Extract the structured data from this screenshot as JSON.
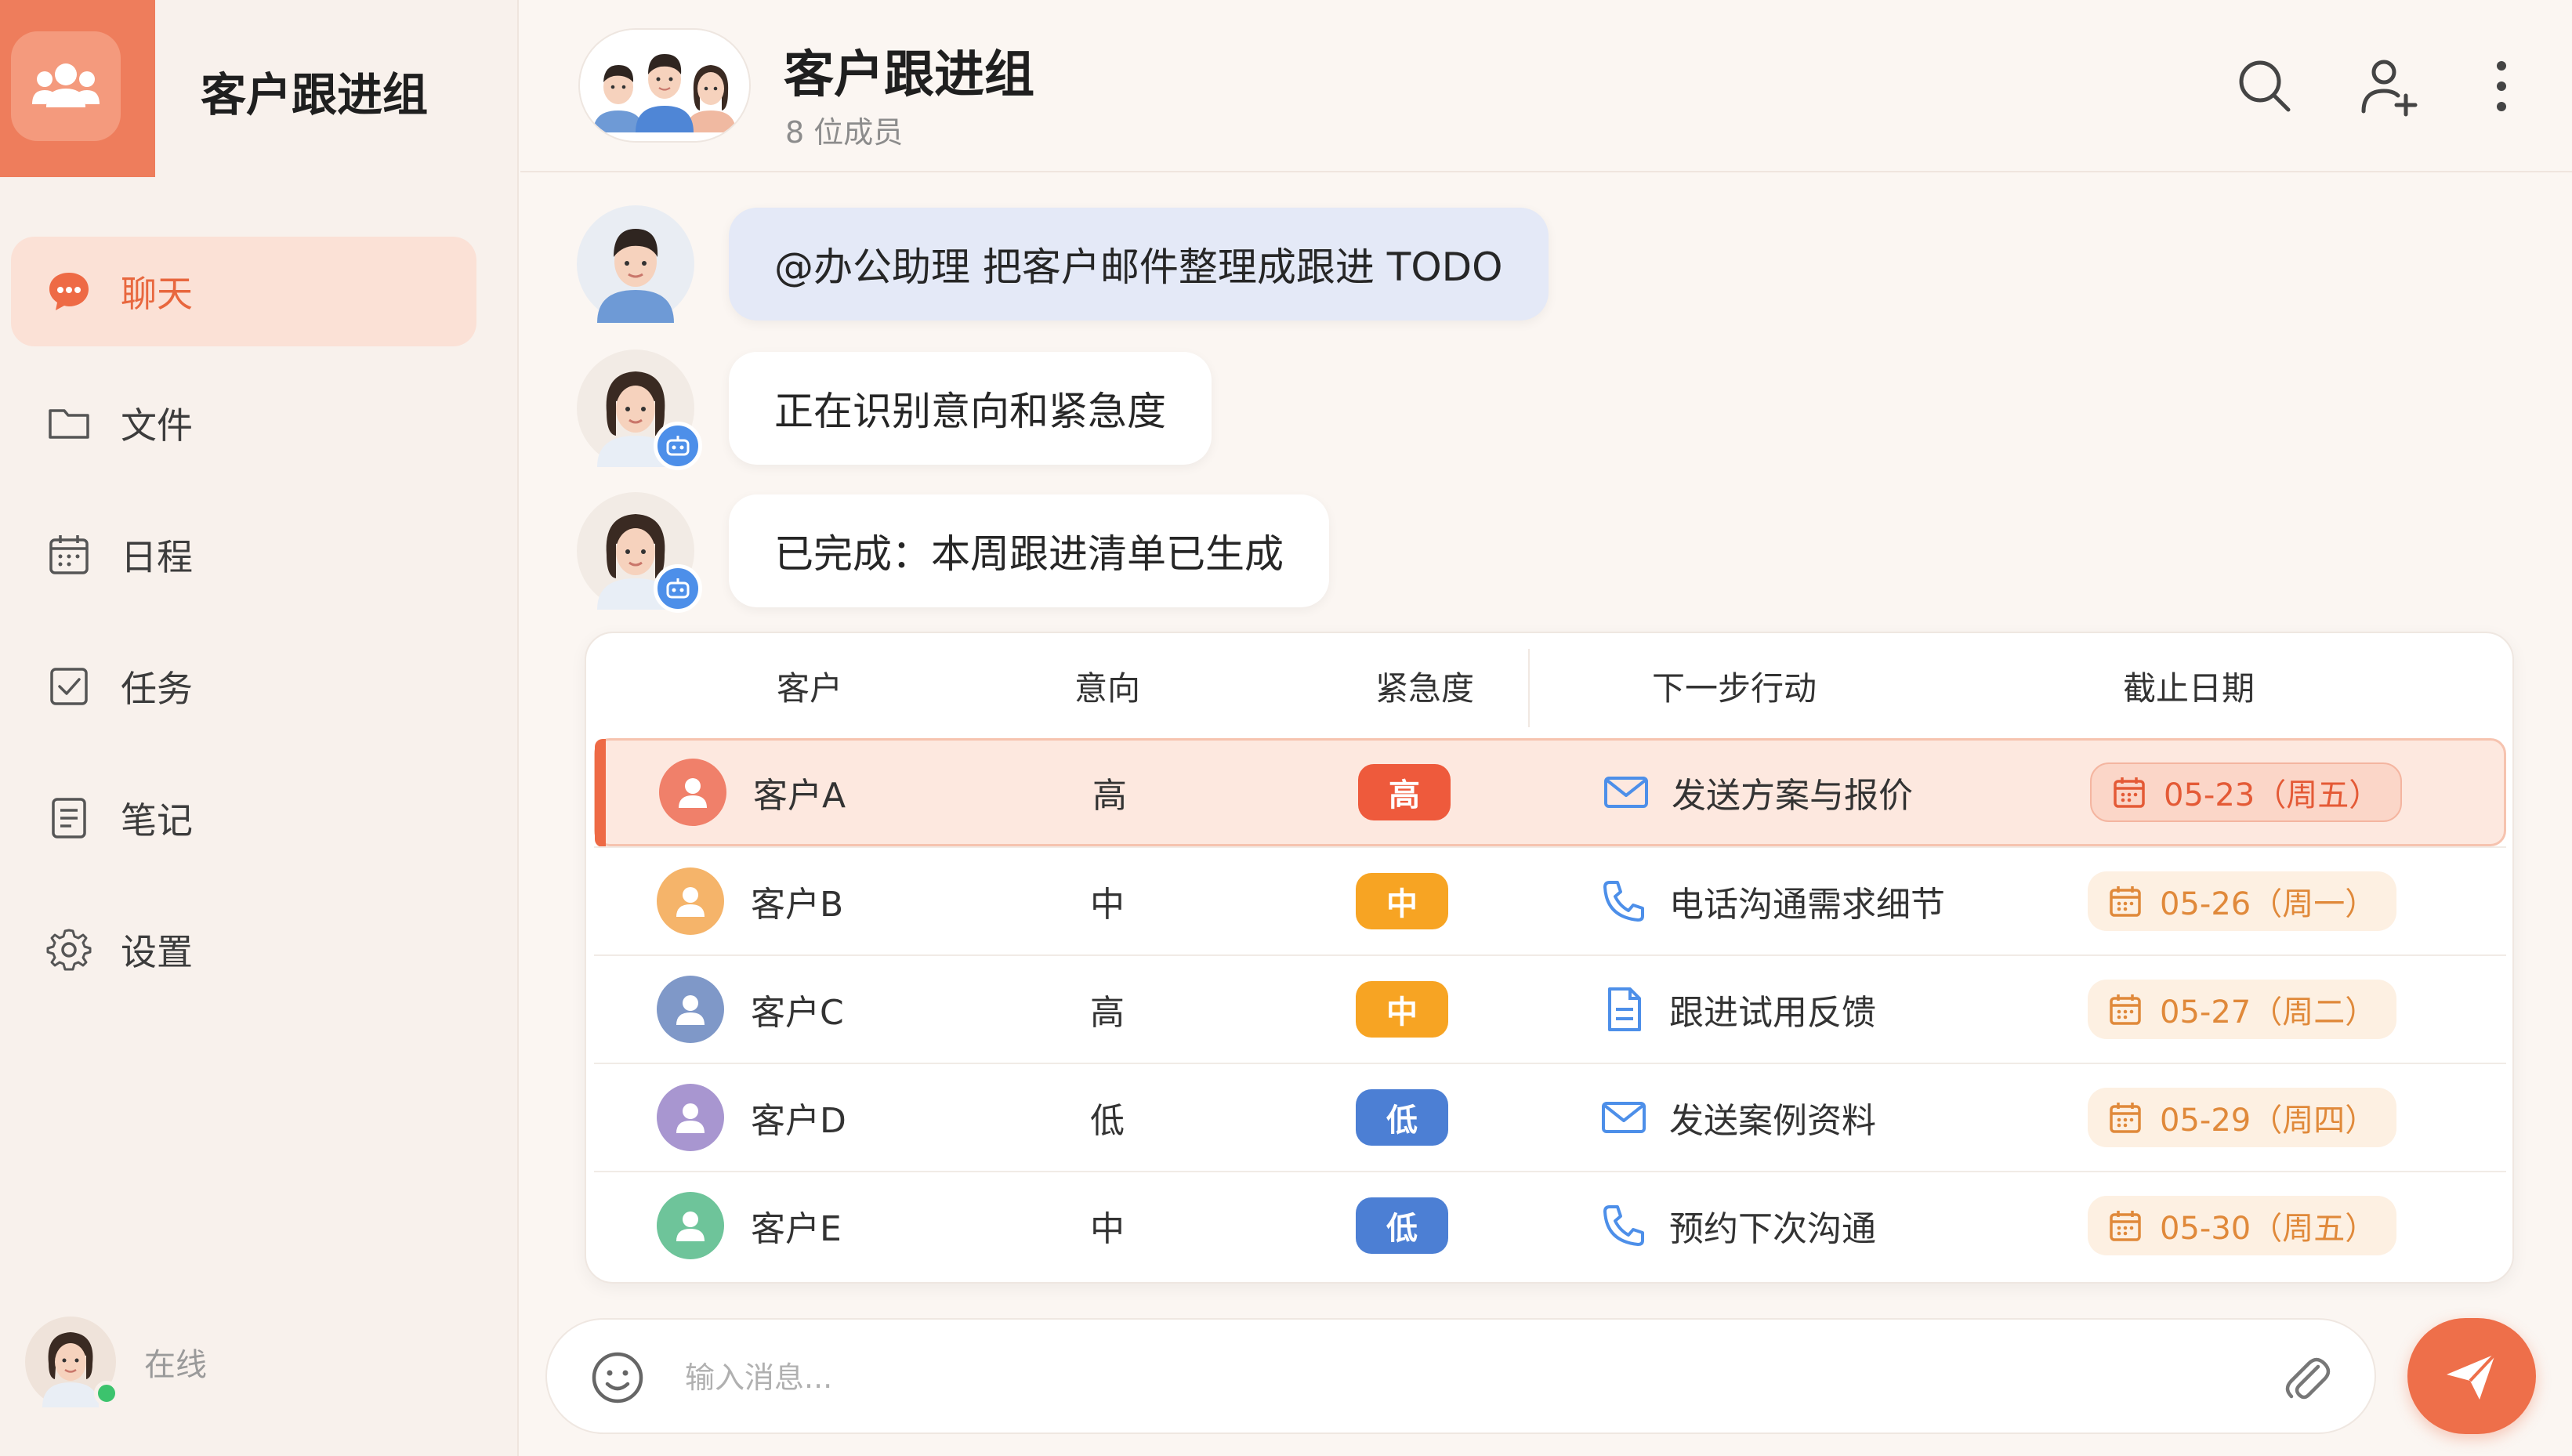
{
  "sidebar": {
    "group_title": "客户跟进组",
    "items": [
      {
        "label": "聊天",
        "icon": "chat-bubble-icon",
        "active": true
      },
      {
        "label": "文件",
        "icon": "folder-icon",
        "active": false
      },
      {
        "label": "日程",
        "icon": "calendar-icon",
        "active": false
      },
      {
        "label": "任务",
        "icon": "checkbox-icon",
        "active": false
      },
      {
        "label": "笔记",
        "icon": "note-icon",
        "active": false
      },
      {
        "label": "设置",
        "icon": "gear-icon",
        "active": false
      }
    ],
    "status": "在线"
  },
  "header": {
    "title": "客户跟进组",
    "subtitle": "8 位成员",
    "actions": [
      "search-icon",
      "add-user-icon",
      "more-vertical-icon"
    ]
  },
  "messages": [
    {
      "sender": "user",
      "text": "@办公助理 把客户邮件整理成跟进 TODO"
    },
    {
      "sender": "bot",
      "text": "正在识别意向和紧急度"
    },
    {
      "sender": "bot",
      "text": "已完成：本周跟进清单已生成"
    }
  ],
  "table": {
    "headers": {
      "customer": "客户",
      "intent": "意向",
      "urgency": "紧急度",
      "action": "下一步行动",
      "deadline": "截止日期"
    },
    "rows": [
      {
        "customer": "客户A",
        "intent": "高",
        "urgency": "高",
        "action": "发送方案与报价",
        "action_icon": "mail-icon",
        "deadline": "05-23（周五）"
      },
      {
        "customer": "客户B",
        "intent": "中",
        "urgency": "中",
        "action": "电话沟通需求细节",
        "action_icon": "phone-icon",
        "deadline": "05-26（周一）"
      },
      {
        "customer": "客户C",
        "intent": "高",
        "urgency": "中",
        "action": "跟进试用反馈",
        "action_icon": "document-icon",
        "deadline": "05-27（周二）"
      },
      {
        "customer": "客户D",
        "intent": "低",
        "urgency": "低",
        "action": "发送案例资料",
        "action_icon": "mail-icon",
        "deadline": "05-29（周四）"
      },
      {
        "customer": "客户E",
        "intent": "中",
        "urgency": "低",
        "action": "预约下次沟通",
        "action_icon": "phone-icon",
        "deadline": "05-30（周五）"
      }
    ]
  },
  "composer": {
    "placeholder": "输入消息..."
  },
  "colors": {
    "accent": "#ee6f4a",
    "urgency_high": "#ee5a3c",
    "urgency_mid": "#f7a423",
    "urgency_low": "#4c7fd4",
    "bot_badge": "#4d8fe9",
    "online": "#3cc36d"
  }
}
